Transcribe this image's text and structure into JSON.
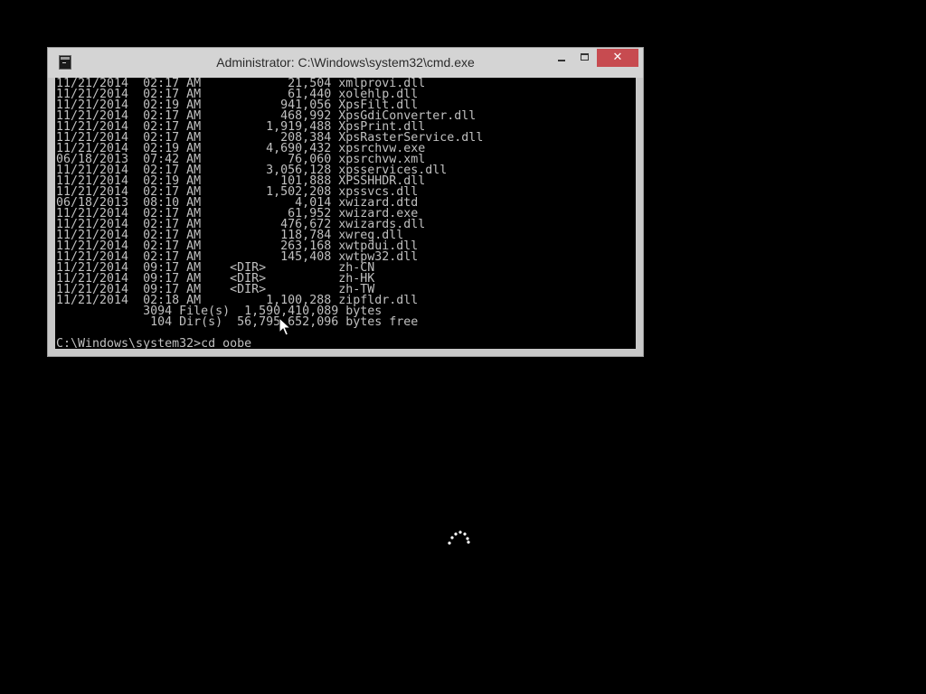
{
  "window": {
    "title": "Administrator: C:\\Windows\\system32\\cmd.exe",
    "close_glyph": "✕"
  },
  "console": {
    "lines": [
      "11/21/2014  02:17 AM            21,504 xmlprovi.dll",
      "11/21/2014  02:17 AM            61,440 xolehlp.dll",
      "11/21/2014  02:19 AM           941,056 XpsFilt.dll",
      "11/21/2014  02:17 AM           468,992 XpsGdiConverter.dll",
      "11/21/2014  02:17 AM         1,919,488 XpsPrint.dll",
      "11/21/2014  02:17 AM           208,384 XpsRasterService.dll",
      "11/21/2014  02:19 AM         4,690,432 xpsrchvw.exe",
      "06/18/2013  07:42 AM            76,060 xpsrchvw.xml",
      "11/21/2014  02:17 AM         3,056,128 xpsservices.dll",
      "11/21/2014  02:19 AM           101,888 XPSSHHDR.dll",
      "11/21/2014  02:17 AM         1,502,208 xpssvcs.dll",
      "06/18/2013  08:10 AM             4,014 xwizard.dtd",
      "11/21/2014  02:17 AM            61,952 xwizard.exe",
      "11/21/2014  02:17 AM           476,672 xwizards.dll",
      "11/21/2014  02:17 AM           118,784 xwreg.dll",
      "11/21/2014  02:17 AM           263,168 xwtpdui.dll",
      "11/21/2014  02:17 AM           145,408 xwtpw32.dll",
      "11/21/2014  09:17 AM    <DIR>          zh-CN",
      "11/21/2014  09:17 AM    <DIR>          zh-HK",
      "11/21/2014  09:17 AM    <DIR>          zh-TW",
      "11/21/2014  02:18 AM         1,100,288 zipfldr.dll",
      "            3094 File(s)  1,590,410,089 bytes",
      "             104 Dir(s)  56,795,652,096 bytes free",
      "",
      "C:\\Windows\\system32>cd oobe"
    ]
  },
  "colors": {
    "console_text": "#c0c0c0",
    "console_bg": "#000000",
    "titlebar_bg": "#d4d4d4",
    "close_button_bg": "#c74b50",
    "desktop_bg": "#000000"
  },
  "icons": {
    "app": "cmd-icon",
    "minimize": "minimize-icon",
    "maximize": "maximize-icon",
    "close": "close-icon",
    "pointer": "mouse-pointer-icon",
    "loading": "loading-spinner-icon"
  }
}
